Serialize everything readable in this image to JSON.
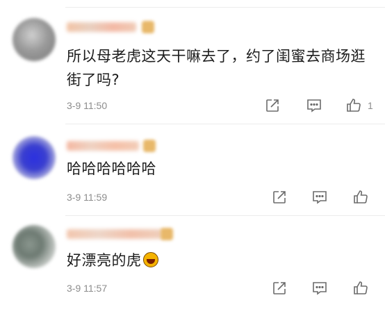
{
  "comments": [
    {
      "text": "所以母老虎这天干嘛去了，约了闺蜜去商场逛街了吗?",
      "time": "3-9 11:50",
      "likes": "1",
      "avatar_colors": [
        "#8a8a8a",
        "#cfcfcf"
      ]
    },
    {
      "text": "哈哈哈哈哈哈",
      "time": "3-9 11:59",
      "likes": "",
      "avatar_colors": [
        "#2a2fd1",
        "#c9c9e8"
      ]
    },
    {
      "text": "好漂亮的虎",
      "time": "3-9 11:57",
      "likes": "",
      "avatar_colors": [
        "#6d7a72",
        "#d4d4d4"
      ]
    }
  ],
  "icons": {
    "forward": "forward-icon",
    "comment": "comment-icon",
    "like": "thumbs-up-icon"
  },
  "colors": {
    "text": "#1c1c1c",
    "meta": "#8c8c8c",
    "icon": "#6b6b6b",
    "divider": "#ececec"
  }
}
